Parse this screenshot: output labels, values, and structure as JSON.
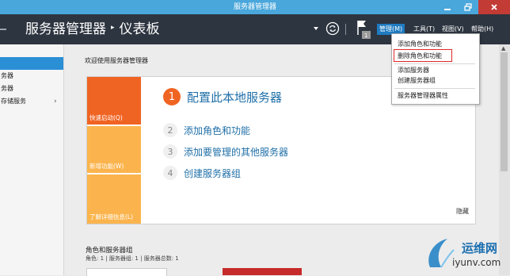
{
  "window": {
    "title": "服务器管理器"
  },
  "header": {
    "app_name": "服务器管理器",
    "separator": "▸",
    "page": "仪表板",
    "flag_badge": "1",
    "menu": [
      {
        "label": "管理(M)",
        "active": true
      },
      {
        "label": "工具(T)"
      },
      {
        "label": "视图(V)"
      },
      {
        "label": "帮助(H)"
      }
    ]
  },
  "sidebar": {
    "items": [
      {
        "label": ""
      },
      {
        "label": "务器"
      },
      {
        "label": "务器"
      },
      {
        "label": "存储服务",
        "chevron": "›"
      }
    ]
  },
  "dropdown": {
    "items": [
      {
        "label": "添加角色和功能"
      },
      {
        "label": "删除角色和功能",
        "highlighted": true
      },
      {
        "label": "添加服务器"
      },
      {
        "label": "创建服务器组"
      },
      {
        "label": "服务器管理器属性"
      }
    ]
  },
  "main": {
    "welcome": "欢迎使用服务器管理器",
    "tiles": [
      {
        "label": "快速启动(Q)",
        "color": "#f06423"
      },
      {
        "label": "新增功能(W)",
        "color": "#fbb44d"
      },
      {
        "label": "了解详细信息(L)",
        "color": "#fbb44d"
      }
    ],
    "tasks": [
      {
        "num": "1",
        "label": "配置此本地服务器"
      },
      {
        "num": "2",
        "label": "添加角色和功能"
      },
      {
        "num": "3",
        "label": "添加要管理的其他服务器"
      },
      {
        "num": "4",
        "label": "创建服务器组"
      }
    ],
    "hide_link": "隐藏",
    "roles": {
      "title": "角色和服务器组",
      "subtitle": "角色: 1 | 服务器组: 1 | 服务器总数: 1"
    }
  },
  "watermark": {
    "text1": "运维网",
    "text2": "iyunv.com"
  },
  "colors": {
    "titlebar": "#4aa7db",
    "header": "#2d3540",
    "accent": "#f06423",
    "tile_secondary": "#fbb44d",
    "menu_active": "#1f7bc1",
    "link": "#1f6fa8",
    "highlight": "#e02a2a"
  }
}
